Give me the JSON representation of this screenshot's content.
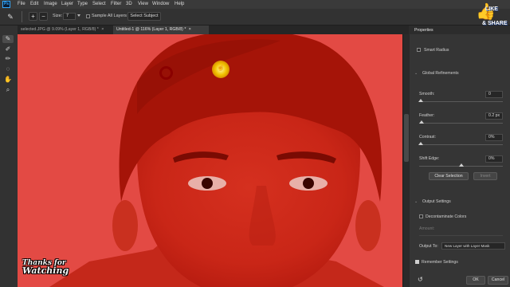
{
  "app": {
    "logo": "Ps"
  },
  "menu": [
    "File",
    "Edit",
    "Image",
    "Layer",
    "Type",
    "Select",
    "Filter",
    "3D",
    "View",
    "Window",
    "Help"
  ],
  "options": {
    "size_label": "Size:",
    "size_value": "7",
    "sample_all_layers": "Sample All Layers",
    "select_subject": "Select Subject"
  },
  "tabs": [
    {
      "label": "selected.JPG @ 9.09% (Layer 1, RGB/8) *",
      "close": "×",
      "active": false
    },
    {
      "label": "Untitled-1 @ 116% (Layer 1, RGB/8) *",
      "close": "×",
      "active": true
    }
  ],
  "tools": [
    "quick-selection-brush-icon",
    "refine-edge-brush-icon",
    "brush-icon",
    "lasso-icon",
    "hand-icon",
    "zoom-icon"
  ],
  "panel": {
    "title": "Properties",
    "smart_radius": "Smart Radius",
    "global_refinements": "Global Refinements",
    "smooth_label": "Smooth:",
    "smooth_value": "0",
    "feather_label": "Feather:",
    "feather_value": "0.2 px",
    "contrast_label": "Contrast:",
    "contrast_value": "0%",
    "shift_edge_label": "Shift Edge:",
    "shift_edge_value": "0%",
    "clear_selection": "Clear Selection",
    "invert": "Invert",
    "output_settings": "Output Settings",
    "decontaminate_colors": "Decontaminate Colors",
    "amount_label": "Amount:",
    "output_to_label": "Output To:",
    "output_to_value": "New Layer with Layer Mask",
    "remember_settings": "Remember Settings",
    "ok": "OK",
    "cancel": "Cancel"
  },
  "overlay": {
    "watermark_line1": "Thanks for",
    "watermark_line2": "Watching",
    "like_badge_line1": "LIKE",
    "like_badge_line2": "& SHARE"
  },
  "colors": {
    "overlay_red": "#d8362e",
    "accent_blue": "#31a8ff",
    "panel_bg": "#353535"
  }
}
